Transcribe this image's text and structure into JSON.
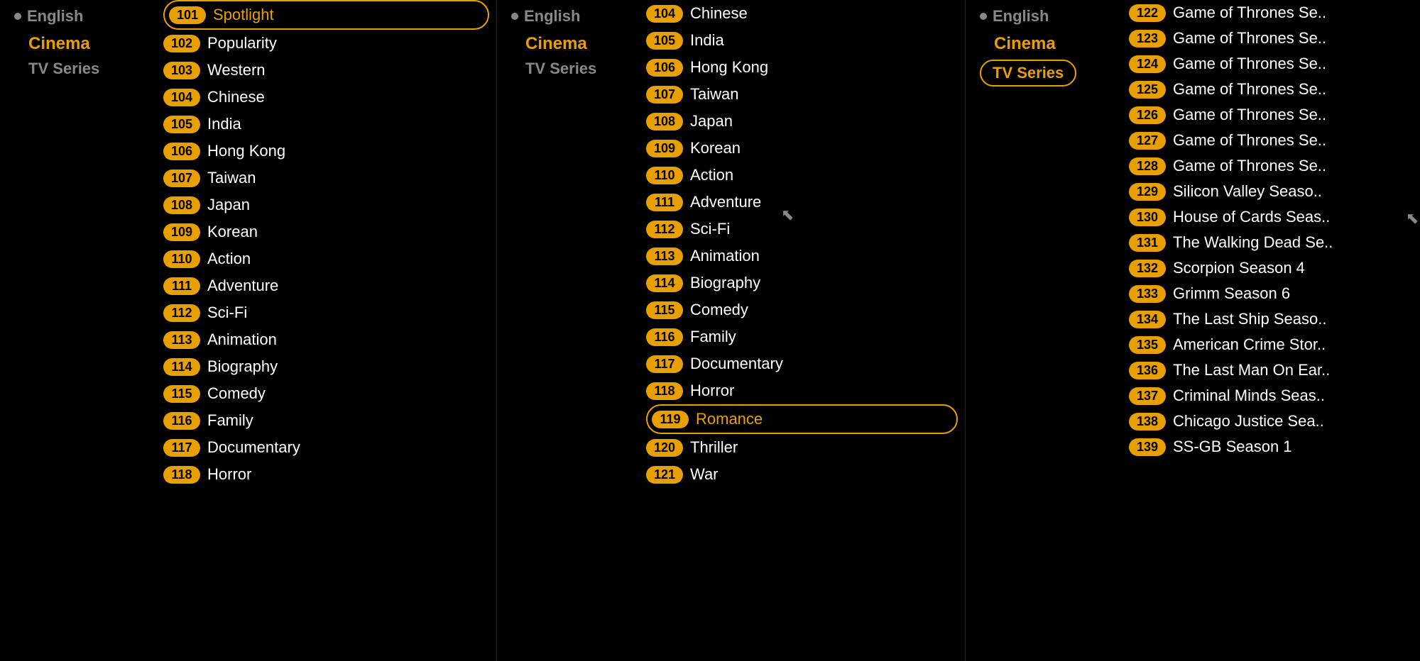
{
  "col1": {
    "nav": {
      "english": "English",
      "cinema": "Cinema",
      "tvseries": "TV  Series"
    },
    "selected_item": "101",
    "items": [
      {
        "id": "101",
        "label": "Spotlight",
        "selected": true
      },
      {
        "id": "102",
        "label": "Popularity"
      },
      {
        "id": "103",
        "label": "Western"
      },
      {
        "id": "104",
        "label": "Chinese"
      },
      {
        "id": "105",
        "label": "India"
      },
      {
        "id": "106",
        "label": "Hong Kong"
      },
      {
        "id": "107",
        "label": "Taiwan"
      },
      {
        "id": "108",
        "label": "Japan"
      },
      {
        "id": "109",
        "label": "Korean"
      },
      {
        "id": "110",
        "label": "Action"
      },
      {
        "id": "111",
        "label": "Adventure"
      },
      {
        "id": "112",
        "label": "Sci-Fi"
      },
      {
        "id": "113",
        "label": "Animation"
      },
      {
        "id": "114",
        "label": "Biography"
      },
      {
        "id": "115",
        "label": "Comedy"
      },
      {
        "id": "116",
        "label": "Family"
      },
      {
        "id": "117",
        "label": "Documentary"
      },
      {
        "id": "118",
        "label": "Horror"
      }
    ]
  },
  "col2": {
    "nav": {
      "english": "English",
      "cinema": "Cinema",
      "tvseries": "TV  Series"
    },
    "items": [
      {
        "id": "104",
        "label": "Chinese"
      },
      {
        "id": "105",
        "label": "India"
      },
      {
        "id": "106",
        "label": "Hong Kong"
      },
      {
        "id": "107",
        "label": "Taiwan"
      },
      {
        "id": "108",
        "label": "Japan"
      },
      {
        "id": "109",
        "label": "Korean"
      },
      {
        "id": "110",
        "label": "Action"
      },
      {
        "id": "111",
        "label": "Adventure"
      },
      {
        "id": "112",
        "label": "Sci-Fi"
      },
      {
        "id": "113",
        "label": "Animation"
      },
      {
        "id": "114",
        "label": "Biography"
      },
      {
        "id": "115",
        "label": "Comedy"
      },
      {
        "id": "116",
        "label": "Family"
      },
      {
        "id": "117",
        "label": "Documentary"
      },
      {
        "id": "118",
        "label": "Horror"
      },
      {
        "id": "119",
        "label": "Romance",
        "selected": true
      },
      {
        "id": "120",
        "label": "Thriller"
      },
      {
        "id": "121",
        "label": "War"
      }
    ]
  },
  "col3": {
    "nav": {
      "english": "English",
      "cinema": "Cinema",
      "tvseries": "TV  Series"
    },
    "tvseries_active": true,
    "tv_items": [
      {
        "id": "122",
        "label": "Game of Thrones Se.."
      },
      {
        "id": "123",
        "label": "Game of Thrones Se.."
      },
      {
        "id": "124",
        "label": "Game of Thrones Se.."
      },
      {
        "id": "125",
        "label": "Game of Thrones Se.."
      },
      {
        "id": "126",
        "label": "Game of Thrones Se.."
      },
      {
        "id": "127",
        "label": "Game of Thrones Se.."
      },
      {
        "id": "128",
        "label": "Game of Thrones Se.."
      },
      {
        "id": "129",
        "label": "Silicon Valley Seaso.."
      },
      {
        "id": "130",
        "label": "House of Cards Seas.."
      },
      {
        "id": "131",
        "label": "The Walking Dead Se.."
      },
      {
        "id": "132",
        "label": "Scorpion Season 4"
      },
      {
        "id": "133",
        "label": "Grimm Season 6"
      },
      {
        "id": "134",
        "label": "The Last Ship Seaso.."
      },
      {
        "id": "135",
        "label": "American Crime Stor.."
      },
      {
        "id": "136",
        "label": "The Last Man On Ear.."
      },
      {
        "id": "137",
        "label": "Criminal Minds Seas.."
      },
      {
        "id": "138",
        "label": "Chicago Justice Sea.."
      },
      {
        "id": "139",
        "label": "SS-GB Season 1"
      }
    ]
  }
}
